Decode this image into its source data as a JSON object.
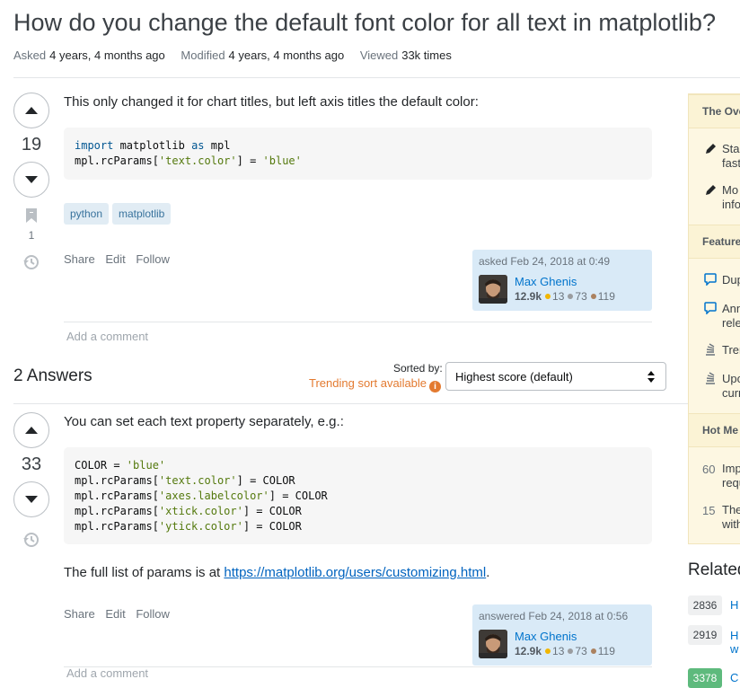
{
  "question": {
    "title": "How do you change the default font color for all text in matplotlib?",
    "asked_label": "Asked",
    "asked_value": "4 years, 4 months ago",
    "modified_label": "Modified",
    "modified_value": "4 years, 4 months ago",
    "viewed_label": "Viewed",
    "viewed_value": "33k times",
    "score": "19",
    "bookmark_count": "1",
    "body_text": "This only changed it for chart titles, but left axis titles the default color:",
    "code": {
      "line1_kw1": "import",
      "line1_mid": " matplotlib ",
      "line1_kw2": "as",
      "line1_end": " mpl",
      "line2_a": "mpl.rcParams[",
      "line2_s1": "'text.color'",
      "line2_b": "] = ",
      "line2_s2": "'blue'"
    },
    "tags": [
      "python",
      "matplotlib"
    ],
    "actions": [
      "Share",
      "Edit",
      "Follow"
    ],
    "signature": {
      "when": "asked Feb 24, 2018 at 0:49",
      "name": "Max Ghenis",
      "rep": "12.9k",
      "gold": "13",
      "silver": "73",
      "bronze": "119"
    },
    "add_comment": "Add a comment"
  },
  "answers_header": {
    "count_label": "2 Answers",
    "sorted_by": "Sorted by:",
    "trending": "Trending sort available",
    "sort_value": "Highest score (default)"
  },
  "answer": {
    "score": "33",
    "intro": "You can set each text property separately, e.g.:",
    "code": {
      "l1a": "COLOR = ",
      "l1s": "'blue'",
      "l2a": "mpl.rcParams[",
      "l2s": "'text.color'",
      "l2b": "] = COLOR",
      "l3a": "mpl.rcParams[",
      "l3s": "'axes.labelcolor'",
      "l3b": "] = COLOR",
      "l4a": "mpl.rcParams[",
      "l4s": "'xtick.color'",
      "l4b": "] = COLOR",
      "l5a": "mpl.rcParams[",
      "l5s": "'ytick.color'",
      "l5b": "] = COLOR"
    },
    "full_list_prefix": "The full list of params is at ",
    "full_list_link": "https://matplotlib.org/users/customizing.html",
    "full_list_suffix": ".",
    "actions": [
      "Share",
      "Edit",
      "Follow"
    ],
    "signature": {
      "when": "answered Feb 24, 2018 at 0:56",
      "name": "Max Ghenis",
      "rep": "12.9k",
      "gold": "13",
      "silver": "73",
      "bronze": "119"
    },
    "add_comment": "Add a comment"
  },
  "sidebar": {
    "section1": "The Ove",
    "s1_items": [
      [
        "Stac",
        "fast"
      ],
      [
        "Mo",
        "info"
      ]
    ],
    "section2": "Feature",
    "s2_items": [
      [
        "Dup"
      ],
      [
        "Ann",
        "rele"
      ],
      [
        "Tren"
      ],
      [
        "Upo",
        "curr"
      ]
    ],
    "section3": "Hot Me",
    "s3_items": [
      {
        "num": "60",
        "lines": [
          "Imp",
          "requ"
        ]
      },
      {
        "num": "15",
        "lines": [
          "The",
          "with"
        ]
      }
    ]
  },
  "related": {
    "title": "Related",
    "items": [
      {
        "count": "2836",
        "text": "H",
        "text2": ""
      },
      {
        "count": "2919",
        "text": "H",
        "text2": "w"
      },
      {
        "count": "3378",
        "text": "C",
        "text2": ""
      }
    ]
  },
  "colors": {
    "accent": "#0074cc",
    "trending": "#e37a30",
    "tag_bg": "#e1ecf4",
    "sidebar_bg": "#fdf7e2",
    "accepted_green": "#5eba7d"
  }
}
